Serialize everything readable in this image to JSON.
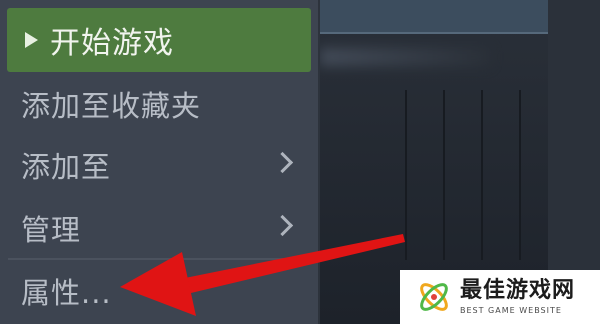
{
  "menu": {
    "play_label": "开始游戏",
    "items": [
      {
        "label": "添加至收藏夹"
      },
      {
        "label": "添加至"
      },
      {
        "label": "管理"
      },
      {
        "label": "属性..."
      }
    ]
  },
  "watermark": {
    "brand_cn": "最佳游戏网",
    "brand_en": "BEST GAME WEBSITE"
  },
  "colors": {
    "play_button": "#4e7b3f",
    "annotation_arrow": "#e01414"
  }
}
